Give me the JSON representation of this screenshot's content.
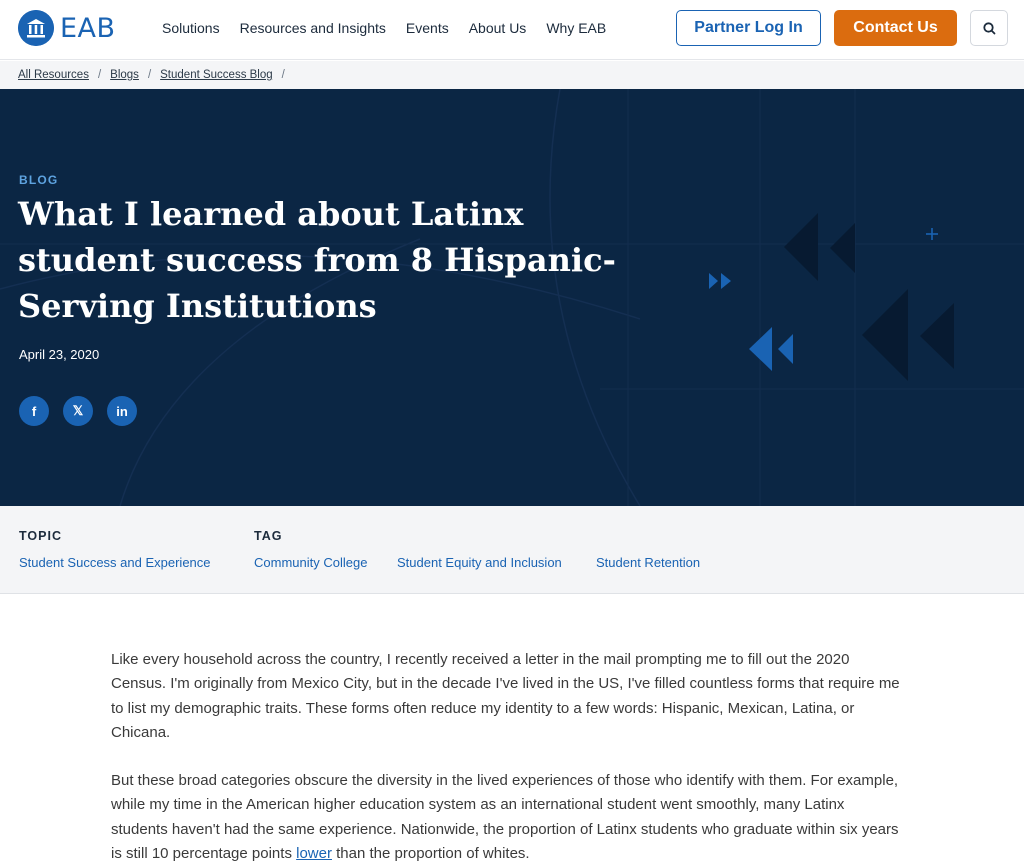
{
  "header": {
    "logo_text": "EAB",
    "nav": [
      "Solutions",
      "Resources and Insights",
      "Events",
      "About Us",
      "Why EAB"
    ],
    "partner_login": "Partner Log In",
    "contact": "Contact Us",
    "search_icon": "search-icon"
  },
  "breadcrumb": [
    "All Resources",
    "Blogs",
    "Student Success Blog"
  ],
  "hero": {
    "eyebrow": "BLOG",
    "title": "What I learned about Latinx student success from 8 Hispanic-Serving Institutions",
    "date": "April 23, 2020",
    "social": [
      {
        "icon": "facebook-icon",
        "glyph": "f"
      },
      {
        "icon": "x-icon",
        "glyph": "𝕏"
      },
      {
        "icon": "linkedin-icon",
        "glyph": "in"
      }
    ]
  },
  "taxonomy": {
    "topic_heading": "TOPIC",
    "topic": "Student Success and Experience",
    "tag_heading": "TAG",
    "tags": [
      "Community College",
      "Student Equity and Inclusion",
      "Student Retention"
    ]
  },
  "article": {
    "p1": "Like every household across the country, I recently received a letter in the mail prompting me to fill out the 2020 Census. I'm originally from Mexico City, but in the decade I've lived in the US, I've filled countless forms that require me to list my demographic traits. These forms often reduce my identity to a few words: Hispanic, Mexican, Latina, or Chicana.",
    "p2_before": "But these broad categories obscure the diversity in the lived experiences of those who identify with them. For example, while my time in the American higher education system as an international student went smoothly, many Latinx students haven't had the same experience. Nationwide, the proportion of Latinx students who graduate within six years is still 10 percentage points ",
    "p2_link": "lower",
    "p2_after": " than the proportion of whites."
  },
  "colors": {
    "brand_blue": "#1a63b3",
    "hero_navy": "#0b2644",
    "accent_orange": "#db6c0f",
    "eyebrow_blue": "#5ea3e0"
  }
}
